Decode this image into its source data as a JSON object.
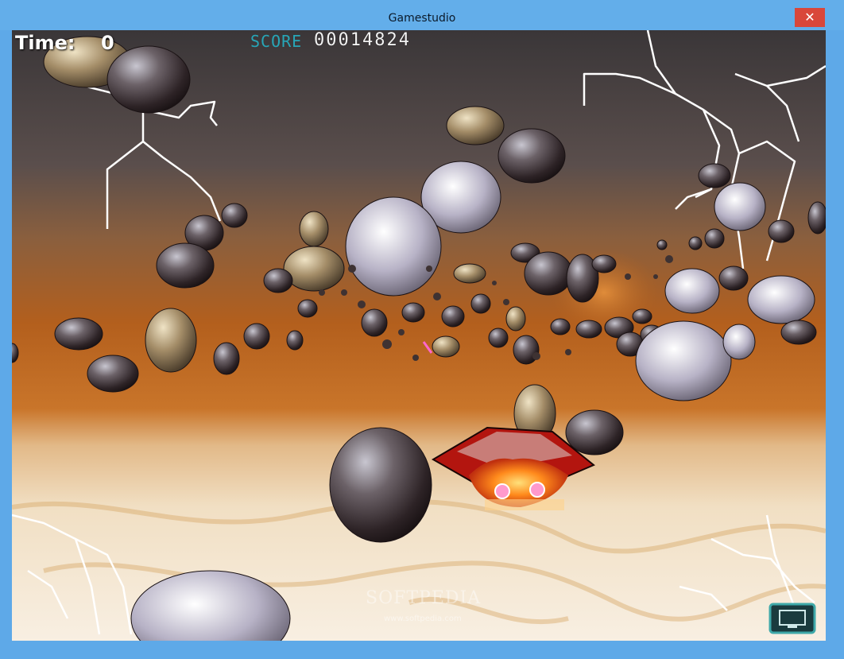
{
  "window": {
    "title": "Gamestudio",
    "close_glyph": "✕"
  },
  "hud": {
    "time_label": "Time:",
    "time_value": "0",
    "score_label": "SCORE",
    "score_value": "00014824"
  },
  "watermark": {
    "brand": "SOFTPEDIA",
    "url": "www.softpedia.com"
  },
  "colors": {
    "titlebar": "#63aeea",
    "close_button": "#d9473a",
    "score_label": "#27a6b7",
    "sky_top": "#3f3a3b",
    "horizon": "#b9631d",
    "ground": "#f3e1c2"
  },
  "icons": {
    "player_ship": "red-orange-spaceship",
    "hud_button": "monitor-icon"
  }
}
